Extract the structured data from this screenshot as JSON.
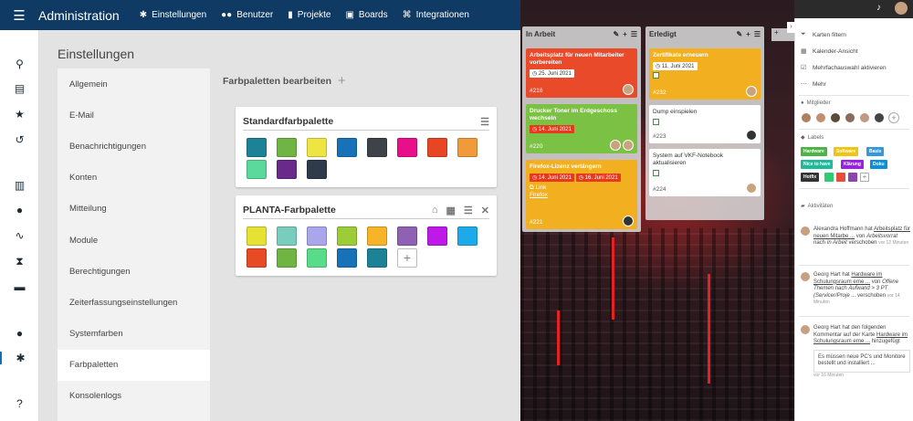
{
  "topbar": {
    "title": "Administration",
    "nav": [
      {
        "icon": "gear-icon",
        "glyph": "✱",
        "label": "Einstellungen"
      },
      {
        "icon": "users-icon",
        "glyph": "👥",
        "label": "Benutzer"
      },
      {
        "icon": "projects-icon",
        "glyph": "▮",
        "label": "Projekte"
      },
      {
        "icon": "board-icon",
        "glyph": "▣",
        "label": "Boards"
      },
      {
        "icon": "integrations-icon",
        "glyph": "⌘",
        "label": "Integrationen"
      }
    ]
  },
  "settings": {
    "title": "Einstellungen",
    "menu": [
      "Allgemein",
      "E-Mail",
      "Benachrichtigungen",
      "Konten",
      "Mitteilung",
      "Module",
      "Berechtigungen",
      "Zeiterfassungseinstellungen",
      "Systemfarben",
      "Farbpaletten",
      "Konsolenlogs"
    ],
    "selected": "Farbpaletten"
  },
  "palettes": {
    "heading": "Farbpaletten bearbeiten",
    "standard": {
      "name": "Standardfarbpalette",
      "colors": [
        "#1e8296",
        "#70b544",
        "#eee543",
        "#1772b8",
        "#3e434a",
        "#e8108a",
        "#e84524",
        "#f09a3b",
        "#5bd99d",
        "#6a2a8a",
        "#2f3b4a"
      ]
    },
    "planta": {
      "name": "PLANTA-Farbpalette",
      "colors": [
        "#e6e234",
        "#78cdbd",
        "#a9a6ec",
        "#9ccd38",
        "#f7b428",
        "#8e61b3",
        "#be19e8",
        "#1cabe8",
        "#e84a25",
        "#70b544",
        "#59dc8a",
        "#1772b8",
        "#1e8296"
      ]
    }
  },
  "board": {
    "columns": [
      {
        "title": "In Arbeit"
      },
      {
        "title": "Erledigt"
      }
    ],
    "cards": [
      {
        "name": "Arbeitsplatz für neuen Mitarbeiter vorbereiten",
        "date": "25. Juni 2021",
        "id": "#216",
        "color": "#e84a2a"
      },
      {
        "name": "Drucker Toner im Erdgeschoss wechseln",
        "date": "14. Juni 2021",
        "id": "#220",
        "color": "#7bc144"
      },
      {
        "name": "Firefox-Lizenz verlängern",
        "date": "14. Juni 2021",
        "date2": "16. Juni 2021",
        "link": "Link",
        "linktext": "Firefox",
        "id": "#221",
        "color": "#f2b020"
      },
      {
        "name": "Zertifikate erneuern",
        "date": "11. Juni 2021",
        "id": "#232",
        "color": "#f2b020"
      },
      {
        "name": "Dump einspielen",
        "id": "#223",
        "color": "#ffffff"
      },
      {
        "name": "System auf VKF-Notebook aktualisieren",
        "id": "#224",
        "color": "#ffffff"
      }
    ]
  },
  "panel": {
    "menu": [
      {
        "icon": "filter-icon",
        "label": "Karten filtern"
      },
      {
        "icon": "calendar-icon",
        "label": "Kalender-Ansicht"
      },
      {
        "icon": "multiselect-icon",
        "label": "Mehrfachauswahl aktivieren"
      },
      {
        "icon": "more-icon",
        "label": "Mehr"
      }
    ],
    "members_label": "Mitglieder",
    "labels_label": "Labels",
    "labels": [
      {
        "text": "Hardware",
        "color": "#4bb543"
      },
      {
        "text": "Software",
        "color": "#f1c40f"
      },
      {
        "text": "Basis",
        "color": "#3498db"
      },
      {
        "text": "Nice to have",
        "color": "#1abc9c"
      },
      {
        "text": "Klärung",
        "color": "#9b1fe8"
      },
      {
        "text": "Doku",
        "color": "#0a91d8"
      },
      {
        "text": "Hotfix",
        "color": "#333333"
      }
    ],
    "label_squares": [
      "#2ecc71",
      "#e74c3c",
      "#8e44ad"
    ],
    "activities_label": "Aktivitäten",
    "activities": [
      {
        "author": "Alexandra Hoffmann",
        "text": "hat",
        "card": "Arbeitsplatz für neuen Mitarbe ...",
        "text2": "von",
        "from": "Arbeitsvorrat",
        "text3": "nach",
        "to": "In Arbeit",
        "text4": "verschoben",
        "time": "vor 12 Minuten"
      },
      {
        "author": "Georg Hart",
        "text": "hat",
        "card": "Hardware im Schulungsraum erne ...",
        "text2": "von",
        "from": "Offene Themen",
        "text3": "nach",
        "to": "Aufwand > 3 PT (Servicer/Proje ...",
        "text4": "verschoben",
        "time": "vor 14 Minuten"
      },
      {
        "author": "Georg Hart",
        "text": "hat den folgenden Kommentar auf der Karte",
        "card": "Hardware im Schulungsraum erne ...",
        "text4": "hinzugefügt",
        "comment": "Es müssen neue PC's und Monitore bestellt und installiert ...",
        "time": "vor 16 Minuten"
      }
    ]
  }
}
